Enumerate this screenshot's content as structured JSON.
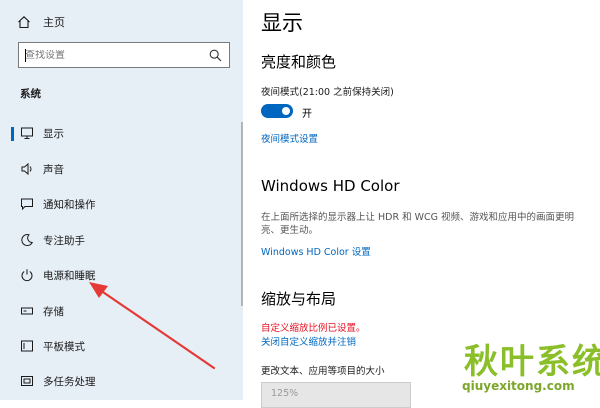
{
  "sidebar": {
    "home_label": "主页",
    "search_placeholder": "查找设置",
    "section_title": "系统",
    "items": [
      {
        "label": "显示",
        "icon": "monitor-icon",
        "selected": true
      },
      {
        "label": "声音",
        "icon": "speaker-icon"
      },
      {
        "label": "通知和操作",
        "icon": "notification-icon"
      },
      {
        "label": "专注助手",
        "icon": "moon-icon"
      },
      {
        "label": "电源和睡眠",
        "icon": "power-icon"
      },
      {
        "label": "存储",
        "icon": "storage-icon"
      },
      {
        "label": "平板模式",
        "icon": "tablet-icon"
      },
      {
        "label": "多任务处理",
        "icon": "multitask-icon"
      }
    ]
  },
  "main": {
    "page_title": "显示",
    "brightness": {
      "heading": "亮度和颜色",
      "night_light_label": "夜间模式(21:00 之前保持关闭)",
      "toggle_state": "开",
      "toggle_on": true,
      "settings_link": "夜间模式设置"
    },
    "hdr": {
      "heading": "Windows HD Color",
      "description": "在上面所选择的显示器上让 HDR 和 WCG 视频、游戏和应用中的画面更明亮、更生动。",
      "settings_link": "Windows HD Color 设置"
    },
    "scale": {
      "heading": "缩放与布局",
      "warning": "自定义缩放比例已设置。",
      "disable_link": "关闭自定义缩放并注销",
      "size_label": "更改文本、应用等项目的大小",
      "size_value": "125%"
    }
  },
  "watermark": {
    "title": "秋叶系统",
    "url": "qiuyexitong.com"
  },
  "colors": {
    "accent": "#0067c0",
    "sidebar_bg": "#e6eef6",
    "warning": "#e81123",
    "annotation_arrow": "#e53935",
    "watermark": "#8bbf2a"
  }
}
